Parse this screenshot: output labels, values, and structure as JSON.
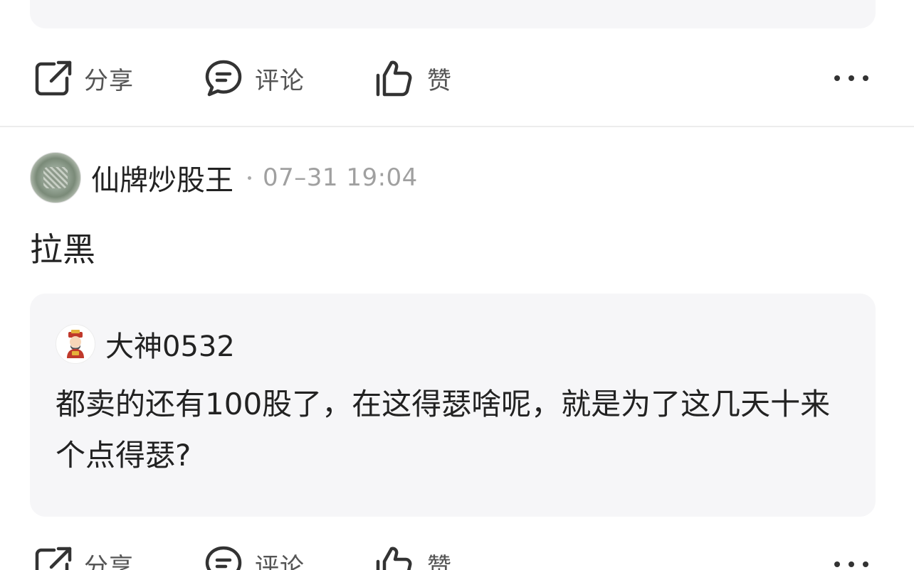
{
  "actions_top": {
    "share_label": "分享",
    "comment_label": "评论",
    "like_label": "赞",
    "icons": {
      "share": "share-icon",
      "comment": "comment-icon",
      "like": "thumbs-up-icon",
      "more": "more-dots-icon"
    }
  },
  "post": {
    "author": "仙牌炒股王",
    "time": "07–31 19:04",
    "content": "拉黑",
    "quote": {
      "username": "大神0532",
      "text": "都卖的还有100股了，在这得瑟啥呢，就是为了这几天十来个点得瑟?"
    }
  },
  "actions_bottom": {
    "share_label": "分享",
    "comment_label": "评论",
    "like_label": "赞"
  },
  "colors": {
    "card_bg": "#f6f6f8",
    "text": "#222222",
    "muted": "#a0a0a0",
    "icon": "#333333"
  }
}
